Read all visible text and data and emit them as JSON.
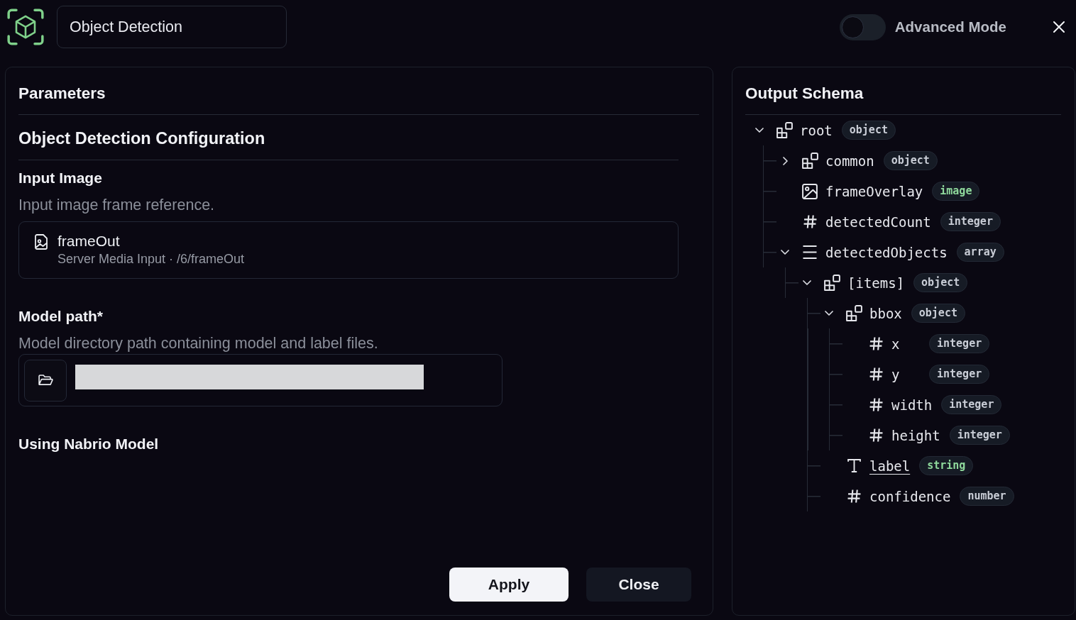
{
  "header": {
    "title_field": {
      "value": "Object Detection"
    },
    "advanced_mode": {
      "label": "Advanced Mode",
      "on": false
    }
  },
  "parameters": {
    "title": "Parameters",
    "section_title": "Object Detection Configuration",
    "input_image": {
      "label": "Input Image",
      "description": "Input image frame reference.",
      "source": {
        "name": "frameOut",
        "detail": "Server Media Input · /6/frameOut"
      }
    },
    "model_path": {
      "label": "Model path*",
      "description": "Model directory path containing model and label files."
    },
    "model_note": "Using Nabrio Model",
    "buttons": [
      {
        "label": "Apply",
        "kind": "primary"
      },
      {
        "label": "Close",
        "kind": "secondary"
      }
    ]
  },
  "output_schema": {
    "title": "Output Schema",
    "nodes": [
      {
        "name": "root",
        "type": "object",
        "kind": "object",
        "expanded": true,
        "hovered": false,
        "children": [
          {
            "name": "common",
            "type": "object",
            "kind": "object",
            "expanded": false,
            "hovered": false
          },
          {
            "name": "frameOverlay",
            "type": "image",
            "kind": "image",
            "hovered": false
          },
          {
            "name": "detectedCount",
            "type": "integer",
            "kind": "number",
            "hovered": false
          },
          {
            "name": "detectedObjects",
            "type": "array",
            "kind": "array",
            "expanded": true,
            "hovered": false,
            "children": [
              {
                "name": "[items]",
                "type": "object",
                "kind": "object",
                "expanded": true,
                "hovered": false,
                "children": [
                  {
                    "name": "bbox",
                    "type": "object",
                    "kind": "object",
                    "expanded": true,
                    "hovered": false,
                    "children": [
                      {
                        "name": "x",
                        "type": "integer",
                        "kind": "number",
                        "hovered": false
                      },
                      {
                        "name": "y",
                        "type": "integer",
                        "kind": "number",
                        "hovered": false
                      },
                      {
                        "name": "width",
                        "type": "integer",
                        "kind": "number",
                        "hovered": false
                      },
                      {
                        "name": "height",
                        "type": "integer",
                        "kind": "number",
                        "hovered": false
                      }
                    ]
                  },
                  {
                    "name": "label",
                    "type": "string",
                    "kind": "string",
                    "hovered": true
                  },
                  {
                    "name": "confidence",
                    "type": "number",
                    "kind": "number",
                    "hovered": false
                  }
                ]
              }
            ]
          }
        ]
      }
    ]
  }
}
